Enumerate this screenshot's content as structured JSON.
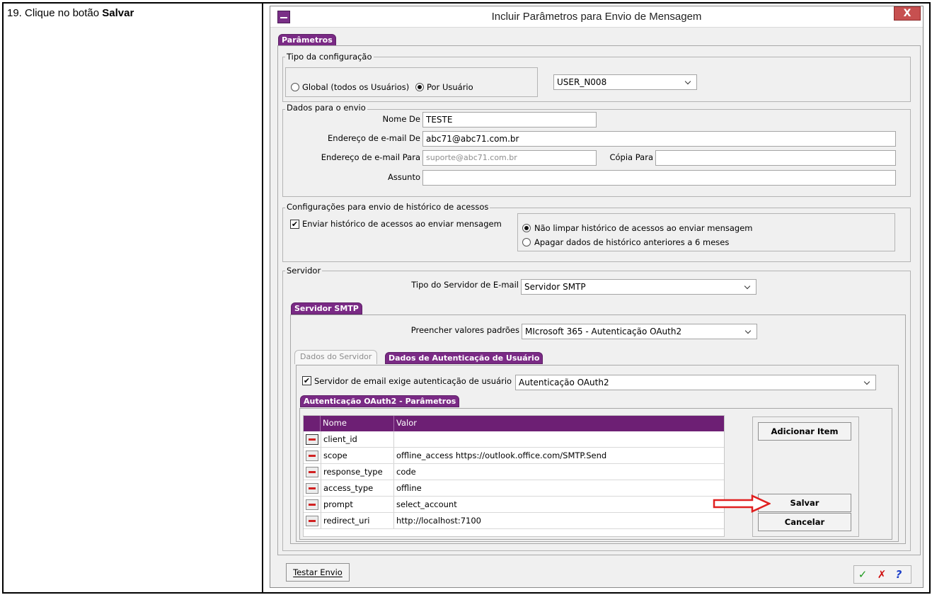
{
  "document": {
    "step_number": "19.",
    "step_text": "Clique no botão",
    "step_target": "Salvar"
  },
  "window": {
    "title": "Incluir Parâmetros para Envio de Mensagem",
    "close_label": "X"
  },
  "tabs": {
    "parametros": "Parâmetros",
    "servidor_smtp": "Servidor SMTP",
    "dados_do_servidor": "Dados do Servidor",
    "dados_autenticacao": "Dados de Autenticação de Usuário",
    "oauth2_params": "Autenticação OAuth2 - Parâmetros"
  },
  "tipo_config": {
    "legend": "Tipo da configuração",
    "option_global": "Global (todos os Usuários)",
    "option_por_usuario": "Por Usuário",
    "selected": "Por Usuário",
    "user_value": "USER_N008"
  },
  "dados_envio": {
    "legend": "Dados para o envio",
    "nome_de_label": "Nome De",
    "nome_de_value": "TESTE",
    "email_de_label": "Endereço de e-mail De",
    "email_de_value": "abc71@abc71.com.br",
    "email_para_label": "Endereço de e-mail Para",
    "email_para_value": "suporte@abc71.com.br",
    "copia_para_label": "Cópia Para",
    "copia_para_value": "",
    "assunto_label": "Assunto",
    "assunto_value": ""
  },
  "historico": {
    "legend": "Configurações para envio de histórico de acessos",
    "enviar_label": "Enviar histórico de acessos ao enviar mensagem",
    "enviar_checked": true,
    "option_nao_limpar": "Não limpar histórico de acessos ao enviar mensagem",
    "option_apagar": "Apagar dados de histórico anteriores a 6 meses",
    "selected": "Não limpar histórico de acessos ao enviar mensagem"
  },
  "servidor": {
    "legend": "Servidor",
    "tipo_label": "Tipo do Servidor de E-mail",
    "tipo_value": "Servidor SMTP",
    "preencher_label": "Preencher valores padrões",
    "preencher_value": "MIcrosoft 365 - Autenticação OAuth2",
    "exige_auth_label": "Servidor de email exige autenticação de usuário",
    "exige_auth_checked": true,
    "auth_type_value": "Autenticação OAuth2"
  },
  "grid": {
    "columns": [
      "Nome",
      "Valor"
    ],
    "rows": [
      {
        "nome": "client_id",
        "valor": ""
      },
      {
        "nome": "scope",
        "valor": "offline_access https://outlook.office.com/SMTP.Send"
      },
      {
        "nome": "response_type",
        "valor": "code"
      },
      {
        "nome": "access_type",
        "valor": "offline"
      },
      {
        "nome": "prompt",
        "valor": "select_account"
      },
      {
        "nome": "redirect_uri",
        "valor": "http://localhost:7100"
      }
    ]
  },
  "buttons": {
    "adicionar_item": "Adicionar Item",
    "salvar": "Salvar",
    "cancelar": "Cancelar",
    "testar_envio": "Testar Envio"
  },
  "icons": {
    "confirm": "check-icon",
    "cancel": "x-icon",
    "help": "help-icon",
    "help_glyph": "?"
  },
  "colors": {
    "accent_purple": "#7a2a85",
    "annotation_arrow": "#e02020",
    "confirm_green": "#1e9a1e",
    "cancel_red": "#d01010",
    "help_blue": "#1c3fc9"
  }
}
